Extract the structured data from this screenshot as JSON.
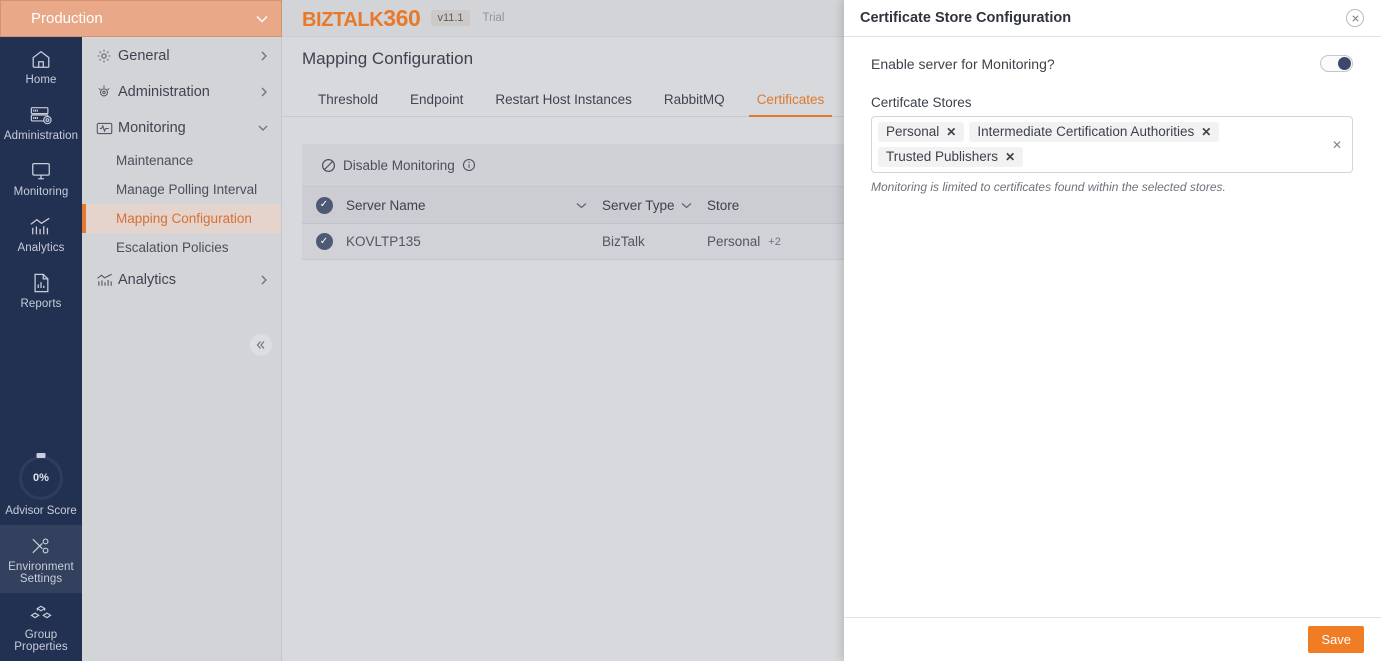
{
  "environment": {
    "name": "Production",
    "chevron": "chevron-down-icon"
  },
  "rail": {
    "items": [
      {
        "label": "Home",
        "icon": "home-icon"
      },
      {
        "label": "Administration",
        "icon": "server-gear-icon"
      },
      {
        "label": "Monitoring",
        "icon": "monitor-icon"
      },
      {
        "label": "Analytics",
        "icon": "chart-icon"
      },
      {
        "label": "Reports",
        "icon": "report-icon"
      }
    ],
    "advisor": {
      "value": "0%",
      "label": "Advisor Score"
    },
    "bottom": [
      {
        "label": "Environment\nSettings",
        "line1": "Environment",
        "line2": "Settings",
        "icon": "tools-icon",
        "active": true
      },
      {
        "label": "Group\nProperties",
        "line1": "Group",
        "line2": "Properties",
        "icon": "cubes-icon",
        "active": false
      }
    ]
  },
  "menu": {
    "groups": [
      {
        "label": "General",
        "icon": "gear-icon",
        "chevron": "chevron-right-icon",
        "expanded": false
      },
      {
        "label": "Administration",
        "icon": "target-icon",
        "chevron": "chevron-right-icon",
        "expanded": false
      },
      {
        "label": "Monitoring",
        "icon": "pulse-icon",
        "chevron": "chevron-down-icon",
        "expanded": true
      }
    ],
    "monitoring_items": [
      {
        "label": "Maintenance",
        "active": false
      },
      {
        "label": "Manage Polling Interval",
        "active": false
      },
      {
        "label": "Mapping Configuration",
        "active": true
      },
      {
        "label": "Escalation Policies",
        "active": false
      }
    ],
    "analytics_group": {
      "label": "Analytics",
      "icon": "chart-icon",
      "chevron": "chevron-right-icon"
    },
    "collapse": "chevron-double-left-icon"
  },
  "header": {
    "logo_part1": "BIZTALK",
    "logo_part2": "360",
    "version": "v11.1",
    "license": "Trial"
  },
  "page": {
    "title": "Mapping Configuration",
    "tabs": [
      {
        "label": "Threshold",
        "active": false
      },
      {
        "label": "Endpoint",
        "active": false
      },
      {
        "label": "Restart Host Instances",
        "active": false
      },
      {
        "label": "RabbitMQ",
        "active": false
      },
      {
        "label": "Certificates",
        "active": true
      }
    ]
  },
  "grid": {
    "toolbar": {
      "disable_label": "Disable Monitoring",
      "disable_icon": "no-entry-icon",
      "info_icon": "info-icon"
    },
    "columns": [
      {
        "label": "Server Name",
        "sort_icon": "chevron-down-icon"
      },
      {
        "label": "Server Type",
        "sort_icon": "chevron-down-icon"
      },
      {
        "label": "Store",
        "sort_icon": ""
      }
    ],
    "rows": [
      {
        "selected": true,
        "server_name": "KOVLTP135",
        "server_type": "BizTalk",
        "store": "Personal",
        "store_extra": "+2"
      }
    ]
  },
  "panel": {
    "title": "Certificate Store Configuration",
    "close_icon": "close-icon",
    "enable_label": "Enable server for Monitoring?",
    "enable_toggle_on": true,
    "stores_label": "Certifcate Stores",
    "stores": [
      {
        "label": "Personal"
      },
      {
        "label": "Intermediate Certification Authorities"
      },
      {
        "label": "Trusted Publishers"
      }
    ],
    "clear_icon": "close-icon",
    "help_text": "Monitoring is limited to certificates found within the selected stores.",
    "save_label": "Save"
  },
  "colors": {
    "accent_orange": "#e0782f",
    "save_orange": "#f07c23",
    "rail_navy": "#223152",
    "env_salmon": "#e9a887",
    "panel_white": "#ffffff",
    "toggle_knob": "#3b4a6b"
  }
}
